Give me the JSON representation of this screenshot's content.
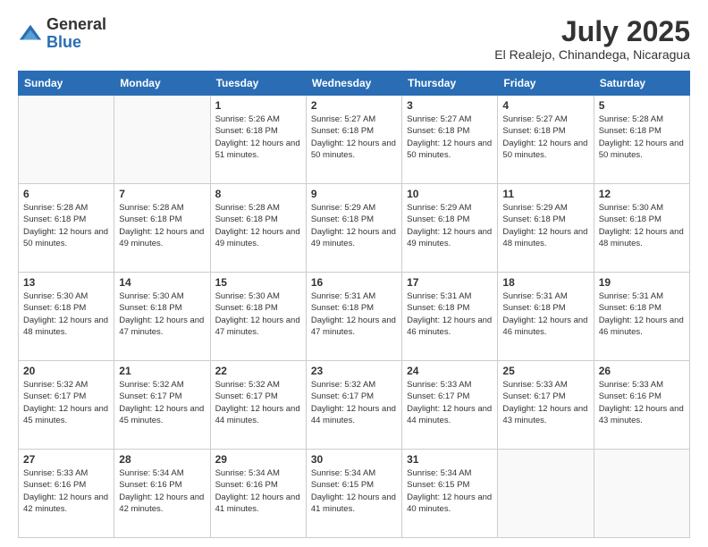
{
  "header": {
    "logo_general": "General",
    "logo_blue": "Blue",
    "month_title": "July 2025",
    "location": "El Realejo, Chinandega, Nicaragua"
  },
  "days_of_week": [
    "Sunday",
    "Monday",
    "Tuesday",
    "Wednesday",
    "Thursday",
    "Friday",
    "Saturday"
  ],
  "weeks": [
    [
      {
        "day": "",
        "info": ""
      },
      {
        "day": "",
        "info": ""
      },
      {
        "day": "1",
        "info": "Sunrise: 5:26 AM\nSunset: 6:18 PM\nDaylight: 12 hours and 51 minutes."
      },
      {
        "day": "2",
        "info": "Sunrise: 5:27 AM\nSunset: 6:18 PM\nDaylight: 12 hours and 50 minutes."
      },
      {
        "day": "3",
        "info": "Sunrise: 5:27 AM\nSunset: 6:18 PM\nDaylight: 12 hours and 50 minutes."
      },
      {
        "day": "4",
        "info": "Sunrise: 5:27 AM\nSunset: 6:18 PM\nDaylight: 12 hours and 50 minutes."
      },
      {
        "day": "5",
        "info": "Sunrise: 5:28 AM\nSunset: 6:18 PM\nDaylight: 12 hours and 50 minutes."
      }
    ],
    [
      {
        "day": "6",
        "info": "Sunrise: 5:28 AM\nSunset: 6:18 PM\nDaylight: 12 hours and 50 minutes."
      },
      {
        "day": "7",
        "info": "Sunrise: 5:28 AM\nSunset: 6:18 PM\nDaylight: 12 hours and 49 minutes."
      },
      {
        "day": "8",
        "info": "Sunrise: 5:28 AM\nSunset: 6:18 PM\nDaylight: 12 hours and 49 minutes."
      },
      {
        "day": "9",
        "info": "Sunrise: 5:29 AM\nSunset: 6:18 PM\nDaylight: 12 hours and 49 minutes."
      },
      {
        "day": "10",
        "info": "Sunrise: 5:29 AM\nSunset: 6:18 PM\nDaylight: 12 hours and 49 minutes."
      },
      {
        "day": "11",
        "info": "Sunrise: 5:29 AM\nSunset: 6:18 PM\nDaylight: 12 hours and 48 minutes."
      },
      {
        "day": "12",
        "info": "Sunrise: 5:30 AM\nSunset: 6:18 PM\nDaylight: 12 hours and 48 minutes."
      }
    ],
    [
      {
        "day": "13",
        "info": "Sunrise: 5:30 AM\nSunset: 6:18 PM\nDaylight: 12 hours and 48 minutes."
      },
      {
        "day": "14",
        "info": "Sunrise: 5:30 AM\nSunset: 6:18 PM\nDaylight: 12 hours and 47 minutes."
      },
      {
        "day": "15",
        "info": "Sunrise: 5:30 AM\nSunset: 6:18 PM\nDaylight: 12 hours and 47 minutes."
      },
      {
        "day": "16",
        "info": "Sunrise: 5:31 AM\nSunset: 6:18 PM\nDaylight: 12 hours and 47 minutes."
      },
      {
        "day": "17",
        "info": "Sunrise: 5:31 AM\nSunset: 6:18 PM\nDaylight: 12 hours and 46 minutes."
      },
      {
        "day": "18",
        "info": "Sunrise: 5:31 AM\nSunset: 6:18 PM\nDaylight: 12 hours and 46 minutes."
      },
      {
        "day": "19",
        "info": "Sunrise: 5:31 AM\nSunset: 6:18 PM\nDaylight: 12 hours and 46 minutes."
      }
    ],
    [
      {
        "day": "20",
        "info": "Sunrise: 5:32 AM\nSunset: 6:17 PM\nDaylight: 12 hours and 45 minutes."
      },
      {
        "day": "21",
        "info": "Sunrise: 5:32 AM\nSunset: 6:17 PM\nDaylight: 12 hours and 45 minutes."
      },
      {
        "day": "22",
        "info": "Sunrise: 5:32 AM\nSunset: 6:17 PM\nDaylight: 12 hours and 44 minutes."
      },
      {
        "day": "23",
        "info": "Sunrise: 5:32 AM\nSunset: 6:17 PM\nDaylight: 12 hours and 44 minutes."
      },
      {
        "day": "24",
        "info": "Sunrise: 5:33 AM\nSunset: 6:17 PM\nDaylight: 12 hours and 44 minutes."
      },
      {
        "day": "25",
        "info": "Sunrise: 5:33 AM\nSunset: 6:17 PM\nDaylight: 12 hours and 43 minutes."
      },
      {
        "day": "26",
        "info": "Sunrise: 5:33 AM\nSunset: 6:16 PM\nDaylight: 12 hours and 43 minutes."
      }
    ],
    [
      {
        "day": "27",
        "info": "Sunrise: 5:33 AM\nSunset: 6:16 PM\nDaylight: 12 hours and 42 minutes."
      },
      {
        "day": "28",
        "info": "Sunrise: 5:34 AM\nSunset: 6:16 PM\nDaylight: 12 hours and 42 minutes."
      },
      {
        "day": "29",
        "info": "Sunrise: 5:34 AM\nSunset: 6:16 PM\nDaylight: 12 hours and 41 minutes."
      },
      {
        "day": "30",
        "info": "Sunrise: 5:34 AM\nSunset: 6:15 PM\nDaylight: 12 hours and 41 minutes."
      },
      {
        "day": "31",
        "info": "Sunrise: 5:34 AM\nSunset: 6:15 PM\nDaylight: 12 hours and 40 minutes."
      },
      {
        "day": "",
        "info": ""
      },
      {
        "day": "",
        "info": ""
      }
    ]
  ]
}
